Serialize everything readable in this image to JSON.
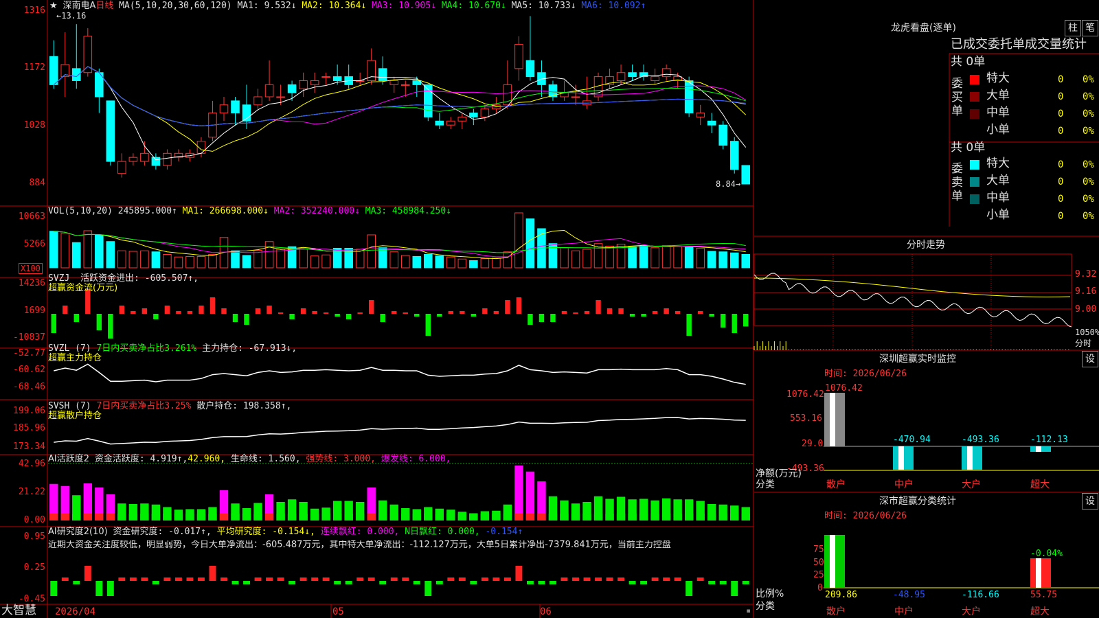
{
  "stock_name": "深南电A",
  "period": "日线",
  "price_panel": {
    "ma_label": "MA(5,10,20,30,60,120)",
    "ma1": "MA1: 9.532↓",
    "ma2": "MA2: 10.364↓",
    "ma3": "MA3: 10.905↓",
    "ma4": "MA4: 10.670↓",
    "ma5": "MA5: 10.733↓",
    "ma6": "MA6: 10.092↑",
    "high_marker": "13.16",
    "low_marker": "8.84",
    "axis": [
      "1316",
      "1172",
      "1028",
      "884"
    ]
  },
  "vol_panel": {
    "label": "VOL(5,10,20)",
    "vol": "245895.000↑",
    "ma1": "MA1: 266698.000↓",
    "ma2": "MA2: 352240.000↓",
    "ma3": "MA3: 458984.250↓",
    "axis": [
      "10663",
      "5266"
    ],
    "unit": "X100"
  },
  "svzj_panel": {
    "label": "SVZJ",
    "active": "活跃资金进出: -605.507↑,",
    "sub": "超赢资金流(万元)",
    "axis": [
      "14236",
      "1699",
      "-10837"
    ]
  },
  "svzl_panel": {
    "label": "SVZL (7)",
    "ratio": "7日内买卖净占比3.261%",
    "hold": "主力持仓: -67.913↓,",
    "sub": "超赢主力持仓",
    "axis": [
      "-52.77",
      "-60.62",
      "-68.46"
    ]
  },
  "svsh_panel": {
    "label": "SVSH (7)",
    "ratio": "7日内买卖净占比3.25%",
    "hold": "散户持仓: 198.358↑,",
    "sub": "超赢散户持仓",
    "axis": [
      "199.06",
      "185.96",
      "173.34"
    ]
  },
  "ai_active_panel": {
    "label": "AI活跃度2",
    "fund": "资金活跃度: 4.919↑,",
    "v2": "42.960,",
    "life": "生命线: 1.560,",
    "strong": "强势线: 3.000,",
    "burst": "爆发线: 6.000,",
    "axis": [
      "42.96",
      "21.22",
      "0.00"
    ]
  },
  "ai_research_panel": {
    "label": "AI研究度2(10)",
    "research": "资金研究度: -0.017↑,",
    "avg": "平均研究度: -0.154↓,",
    "cont": "连续飘红: 0.000,",
    "nday": "N日飘红: 0.000,",
    "last": "-0.154↑",
    "comment": "近期大资金关注度较低，明显弱势，今日大单净流出：-605.487万元，其中特大单净流出：-112.127万元，大单5日累计净出-7379.841万元，当前主力控盘",
    "axis": [
      "0.95",
      "0.25",
      "-0.45"
    ]
  },
  "bottom_bar": {
    "brand": "大智慧",
    "date_start": "2026/04",
    "m05": "05",
    "m06": "06"
  },
  "right_panel": {
    "dragon": {
      "title": "龙虎看盘(逐单)",
      "tab1": "柱",
      "tab2": "笔",
      "header": "已成交委托单成交量统计",
      "buy_label": "委买单",
      "sell_label": "委卖单",
      "buy_total": "共 0单",
      "sell_total": "共 0单",
      "buy_rows": [
        {
          "name": "特大",
          "val": "0",
          "pct": "0%",
          "color": "#ff0000"
        },
        {
          "name": "大单",
          "val": "0",
          "pct": "0%",
          "color": "#8b0000"
        },
        {
          "name": "中单",
          "val": "0",
          "pct": "0%",
          "color": "#600000"
        },
        {
          "name": "小单",
          "val": "0",
          "pct": "0%",
          "color": "#000000"
        }
      ],
      "sell_rows": [
        {
          "name": "特大",
          "val": "0",
          "pct": "0%",
          "color": "#00ffff"
        },
        {
          "name": "大单",
          "val": "0",
          "pct": "0%",
          "color": "#008888"
        },
        {
          "name": "中单",
          "val": "0",
          "pct": "0%",
          "color": "#006060"
        },
        {
          "name": "小单",
          "val": "0",
          "pct": "0%",
          "color": "#000000"
        }
      ]
    },
    "intraday": {
      "title": "分时走势",
      "axis": [
        "9.32",
        "9.16",
        "9.00"
      ],
      "vol_label": "1050%",
      "vol_unit": "分时"
    },
    "monitor": {
      "title": "深圳超赢实时监控",
      "settings": "设",
      "time": "时间: 2026/06/26",
      "axis": [
        "1076.42",
        "553.16",
        "29.0",
        "-493.36"
      ],
      "y_label": "净额(万元)",
      "x_label": "分类",
      "values": [
        "1076.42",
        "-470.94",
        "-493.36",
        "-112.13"
      ],
      "categories": [
        "散户",
        "中户",
        "大户",
        "超大"
      ]
    },
    "stats": {
      "title": "深市超赢分类统计",
      "settings": "设",
      "time": "时间: 2026/06/26",
      "axis": [
        "75",
        "50",
        "25",
        "0"
      ],
      "y_label": "比例%",
      "x_label": "分类",
      "top_value": "-0.04%",
      "values": [
        "209.86",
        "-48.95",
        "-116.66",
        "55.75"
      ],
      "categories": [
        "散户",
        "中户",
        "大户",
        "超大"
      ]
    }
  },
  "chart_data": [
    {
      "type": "candlestick",
      "title": "深南电A 日线",
      "ylim": [
        8.84,
        13.16
      ],
      "candles": [
        [
          12.0,
          11.3,
          12.4,
          11.2
        ],
        [
          11.5,
          11.8,
          12.6,
          11.0
        ],
        [
          11.7,
          11.4,
          12.8,
          11.2
        ],
        [
          11.6,
          12.5,
          12.7,
          11.5
        ],
        [
          11.6,
          11.0,
          11.7,
          10.6
        ],
        [
          10.9,
          9.4,
          10.9,
          9.3
        ],
        [
          9.1,
          9.4,
          9.6,
          9.0
        ],
        [
          9.4,
          9.5,
          9.6,
          9.3
        ],
        [
          9.4,
          9.6,
          9.9,
          9.3
        ],
        [
          9.5,
          9.3,
          9.6,
          9.2
        ],
        [
          9.3,
          9.6,
          9.7,
          9.2
        ],
        [
          9.5,
          9.6,
          9.7,
          9.4
        ],
        [
          9.5,
          9.6,
          9.7,
          9.4
        ],
        [
          9.6,
          9.9,
          10.0,
          9.5
        ],
        [
          10.0,
          10.6,
          10.9,
          9.9
        ],
        [
          10.6,
          10.8,
          11.0,
          10.4
        ],
        [
          10.9,
          10.6,
          11.0,
          10.3
        ],
        [
          10.8,
          10.4,
          11.3,
          10.2
        ],
        [
          10.8,
          11.0,
          11.2,
          10.7
        ],
        [
          11.0,
          11.3,
          11.9,
          10.9
        ],
        [
          11.0,
          11.0,
          11.3,
          10.8
        ],
        [
          11.3,
          11.1,
          11.4,
          10.9
        ],
        [
          11.2,
          11.4,
          11.6,
          11.0
        ],
        [
          11.3,
          11.4,
          11.6,
          11.1
        ],
        [
          11.5,
          11.5,
          11.6,
          11.3
        ],
        [
          11.5,
          11.4,
          11.8,
          11.3
        ],
        [
          11.5,
          11.3,
          11.8,
          11.2
        ],
        [
          11.4,
          11.4,
          11.6,
          11.3
        ],
        [
          11.4,
          11.9,
          12.2,
          11.3
        ],
        [
          11.7,
          11.4,
          12.0,
          11.3
        ],
        [
          11.3,
          11.4,
          11.5,
          11.1
        ],
        [
          11.3,
          11.3,
          11.4,
          11.0
        ],
        [
          11.4,
          11.3,
          11.5,
          11.0
        ],
        [
          11.3,
          10.5,
          11.3,
          10.4
        ],
        [
          10.4,
          10.3,
          10.6,
          10.2
        ],
        [
          10.3,
          10.4,
          10.5,
          10.2
        ],
        [
          10.4,
          10.5,
          10.6,
          10.2
        ],
        [
          10.6,
          10.5,
          10.7,
          10.3
        ],
        [
          10.5,
          10.7,
          10.8,
          10.4
        ],
        [
          10.7,
          10.8,
          11.0,
          10.6
        ],
        [
          10.8,
          11.3,
          11.9,
          10.7
        ],
        [
          11.7,
          12.3,
          12.5,
          11.4
        ],
        [
          11.9,
          11.5,
          13.0,
          11.4
        ],
        [
          11.6,
          11.3,
          11.9,
          11.0
        ],
        [
          11.3,
          11.0,
          11.4,
          10.9
        ],
        [
          11.0,
          11.1,
          11.4,
          10.9
        ],
        [
          11.0,
          11.0,
          11.3,
          10.8
        ],
        [
          10.8,
          10.9,
          11.5,
          10.7
        ],
        [
          11.0,
          11.5,
          11.6,
          10.9
        ],
        [
          11.3,
          11.5,
          11.7,
          11.2
        ],
        [
          11.4,
          11.6,
          11.8,
          11.3
        ],
        [
          11.6,
          11.5,
          11.8,
          11.4
        ],
        [
          11.6,
          11.5,
          11.8,
          11.4
        ],
        [
          11.4,
          11.5,
          11.7,
          11.3
        ],
        [
          11.5,
          11.7,
          11.8,
          11.4
        ],
        [
          11.4,
          11.5,
          11.6,
          11.2
        ],
        [
          11.4,
          10.6,
          11.5,
          10.5
        ],
        [
          10.5,
          10.6,
          10.8,
          10.3
        ],
        [
          10.4,
          10.3,
          10.6,
          10.1
        ],
        [
          10.3,
          9.8,
          10.4,
          9.7
        ],
        [
          9.9,
          9.2,
          10.0,
          9.1
        ],
        [
          9.3,
          8.84,
          9.3,
          8.84
        ]
      ]
    },
    {
      "type": "bar",
      "title": "VOL(5,10,20)",
      "ylim": [
        0,
        10663
      ],
      "values": [
        7100,
        6700,
        4900,
        7200,
        6400,
        5100,
        3300,
        3200,
        3300,
        3100,
        2600,
        2100,
        2200,
        2200,
        2600,
        5900,
        3300,
        2400,
        3400,
        5100,
        3600,
        4100,
        3600,
        2300,
        2500,
        3800,
        3800,
        3600,
        6400,
        3900,
        3100,
        2400,
        2200,
        2600,
        2300,
        2100,
        1700,
        1400,
        1800,
        1900,
        3100,
        10663,
        9500,
        7600,
        4700,
        3900,
        3300,
        3600,
        4700,
        4200,
        4600,
        4100,
        4200,
        3900,
        4300,
        4100,
        4100,
        3800,
        3200,
        3100,
        2900,
        2600
      ]
    }
  ]
}
